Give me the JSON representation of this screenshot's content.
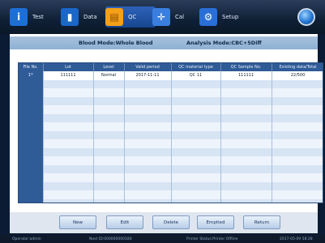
{
  "nav": {
    "tabs": [
      {
        "label": "Test",
        "icon": "test-icon"
      },
      {
        "label": "Data",
        "icon": "chart-icon"
      },
      {
        "label": "QC",
        "icon": "qc-icon"
      },
      {
        "label": "Cal",
        "icon": "calibration-icon"
      },
      {
        "label": "Setup",
        "icon": "gear-icon"
      }
    ]
  },
  "mode": {
    "blood_mode": "Blood Mode:Whole Blood",
    "analysis_mode": "Analysis Mode:CBC+5Diff"
  },
  "table": {
    "headers": [
      "File No.",
      "Lot",
      "Level",
      "Valid period",
      "QC material type",
      "QC Sample No.",
      "Existing data/Total"
    ],
    "rows": [
      [
        "1*",
        "111111",
        "Normal",
        "2017-11-11",
        "QC 11",
        "111111",
        "22/500"
      ]
    ]
  },
  "buttons": {
    "new": "New",
    "edit": "Edit",
    "delete": "Delete",
    "emptied": "Emptied",
    "return": "Return"
  },
  "status": {
    "operator": "Operator:admin",
    "next_id": "Next ID:000000000180",
    "printer": "Printer Status:Printer Offline",
    "datetime": "2017-05-09 58:28"
  }
}
